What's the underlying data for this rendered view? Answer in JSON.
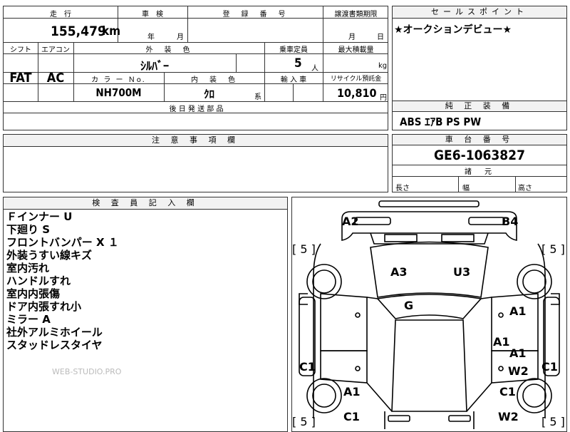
{
  "sheet": {
    "top_row": {
      "distance_label": "走　行",
      "inspection_label": "車　検",
      "registration_label": "登　録　番　号",
      "transfer_docs_label": "譲渡書類期限",
      "sales_point_label": "セールスポイント",
      "mileage_value": "155,479",
      "mileage_unit": "km",
      "year_unit": "年",
      "month_unit": "月",
      "transfer_month_unit": "月",
      "transfer_day_unit": "日",
      "sales_point_text": "★オークションデビュー★"
    },
    "spec_row": {
      "shift_label": "シフト",
      "aircon_label": "エアコン",
      "exterior_color_label": "外　装　色",
      "capacity_label": "乗車定員",
      "max_load_label": "最大積載量",
      "shift_value": "FAT",
      "aircon_value": "AC",
      "exterior_color_value": "ｼﾙﾊﾞｰ",
      "capacity_value": "5",
      "capacity_unit": "人",
      "max_load_unit": "kg",
      "color_no_label": "カ ラ ー Ｎo.",
      "interior_color_label": "内　装　色",
      "import_label": "輸 入 車",
      "recycle_label": "リサイクル預託金",
      "color_no_value": "NH700M",
      "interior_color_value": "ｸﾛ",
      "interior_suffix": "系",
      "recycle_value": "10,810",
      "recycle_unit": "円"
    },
    "parts_label": "後 日 発 送 部 品",
    "equipment_label": "純 正 装 備",
    "equipment_value": "ABS ｴｱB PS PW",
    "notes_label": "注 意 事 項 欄",
    "chassis_label": "車 台 番 号",
    "chassis_value": "GE6-1063827",
    "dimensions_label": "諸　元",
    "length_label": "長さ",
    "width_label": "幅",
    "height_label": "高さ",
    "inspector_label": "検 査 員 記 入 欄",
    "inspector_notes": [
      "Ｆインナー U",
      "下廻り S",
      "フロントバンパー X １",
      "外装うすい線キズ",
      "室内汚れ",
      "ハンドルすれ",
      "室内内張傷",
      "ドア内張すれ小",
      "ミラー A",
      "社外アルミホイール",
      "スタッドレスタイヤ"
    ],
    "watermark": "WEB-STUDIO.PRO"
  },
  "diagram": {
    "marks": {
      "front_left": "A2",
      "front_right": "B4",
      "hood_left": "A3",
      "hood_right": "U3",
      "glass": "G",
      "right_front_door": "A1",
      "right_center": "A1",
      "right_rear_door": "A1",
      "right_rear_lower": "W2",
      "left_front_fender": "C1",
      "right_front_fender": "C1",
      "left_rear_panel": "A1",
      "right_rear_panel": "C1",
      "left_rear_bottom": "C1",
      "right_rear_bottom": "W2"
    },
    "tire_left_top": "[ 5 ]",
    "tire_right_top": "[ 5 ]",
    "tire_left_bottom": "[ 5 ]",
    "tire_right_bottom": "[ 5 ]"
  }
}
